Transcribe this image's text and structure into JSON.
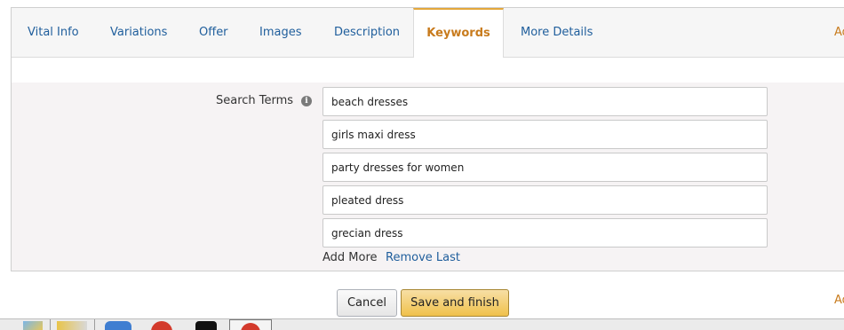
{
  "tabs": [
    {
      "label": "Vital Info",
      "active": false
    },
    {
      "label": "Variations",
      "active": false
    },
    {
      "label": "Offer",
      "active": false
    },
    {
      "label": "Images",
      "active": false
    },
    {
      "label": "Description",
      "active": false
    },
    {
      "label": "Keywords",
      "active": true
    },
    {
      "label": "More Details",
      "active": false
    }
  ],
  "tab_edge_text": "Ad",
  "search_terms": {
    "label": "Search Terms",
    "info_icon": "info-icon",
    "values": [
      "beach dresses",
      "girls maxi dress",
      "party dresses for women",
      "pleated dress",
      "grecian dress"
    ],
    "add_more_label": "Add More",
    "remove_last_label": "Remove Last"
  },
  "buttons": {
    "cancel_label": "Cancel",
    "save_label": "Save and finish"
  },
  "footer_edge_text": "Ad",
  "colors": {
    "link": "#1f5e9c",
    "active_tab": "#c87b1d",
    "primary_button": "#f0c14b"
  }
}
